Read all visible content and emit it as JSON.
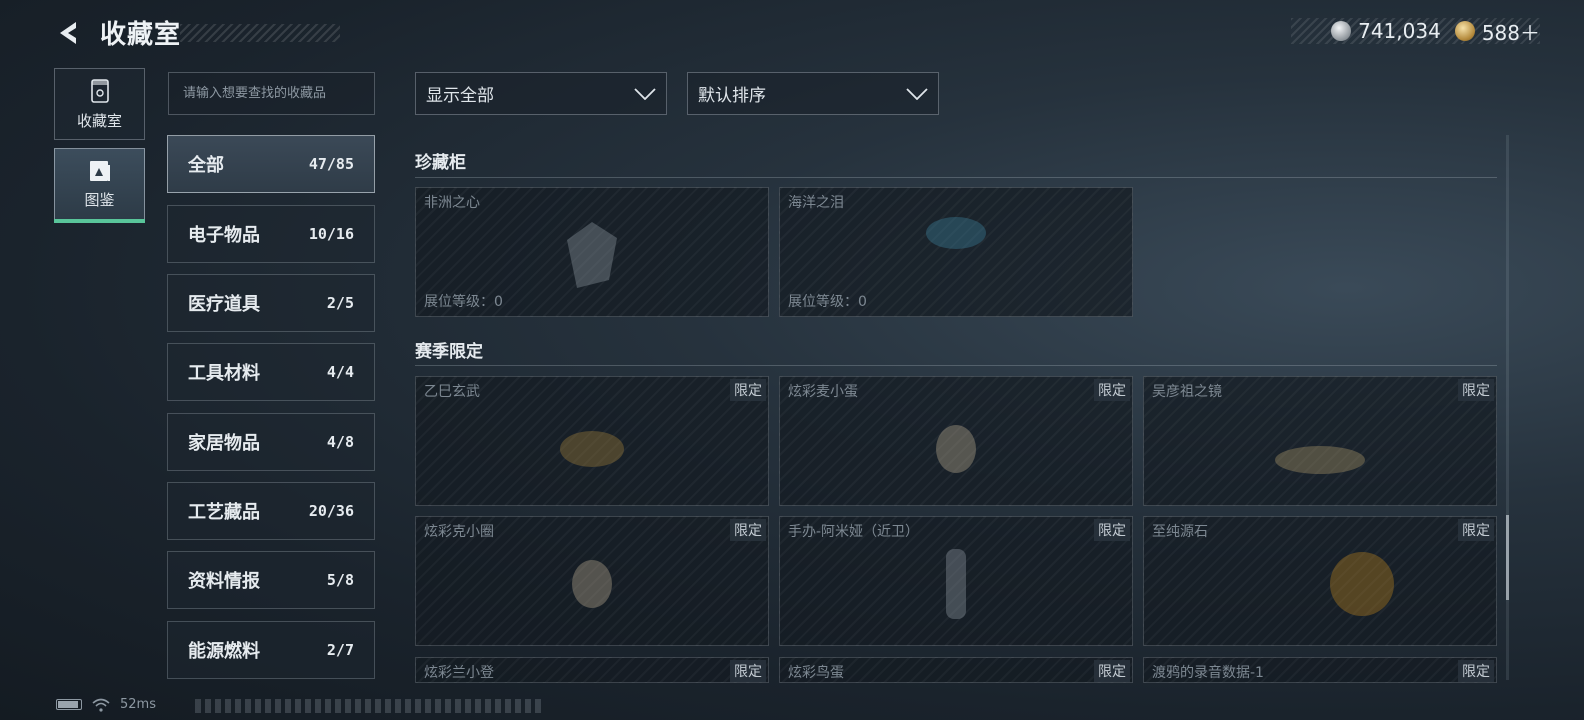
{
  "header": {
    "title": "收藏室",
    "silver_amount": "741,034",
    "gold_amount": "588＋"
  },
  "nav": {
    "tabs": [
      {
        "label": "收藏室",
        "icon": "collection-icon"
      },
      {
        "label": "图鉴",
        "icon": "atlas-icon",
        "active": true
      }
    ]
  },
  "search": {
    "placeholder": "请输入想要查找的收藏品"
  },
  "categories": [
    {
      "name": "全部",
      "count": "47/85",
      "active": true
    },
    {
      "name": "电子物品",
      "count": "10/16"
    },
    {
      "name": "医疗道具",
      "count": "2/5"
    },
    {
      "name": "工具材料",
      "count": "4/4"
    },
    {
      "name": "家居物品",
      "count": "4/8"
    },
    {
      "name": "工艺藏品",
      "count": "20/36"
    },
    {
      "name": "资料情报",
      "count": "5/8"
    },
    {
      "name": "能源燃料",
      "count": "2/7"
    }
  ],
  "filters": {
    "show": "显示全部",
    "sort": "默认排序"
  },
  "sections": [
    {
      "title": "珍藏柜",
      "items": [
        {
          "name": "非洲之心",
          "level": "展位等级：0"
        },
        {
          "name": "海洋之泪",
          "level": "展位等级：0"
        }
      ]
    },
    {
      "title": "赛季限定",
      "badge": "限定",
      "items": [
        {
          "name": "乙巳玄武"
        },
        {
          "name": "炫彩麦小蛋"
        },
        {
          "name": "吴彦祖之镜"
        },
        {
          "name": "炫彩克小圈"
        },
        {
          "name": "手办-阿米娅（近卫）"
        },
        {
          "name": "至纯源石"
        },
        {
          "name": "炫彩兰小登"
        },
        {
          "name": "炫彩鸟蛋"
        },
        {
          "name": "渡鸦的录音数据-1"
        }
      ]
    }
  ],
  "status": {
    "ping": "52ms",
    "battery_level": 0.9
  },
  "colors": {
    "accent": "#59c59a",
    "background": "#1a232c"
  }
}
